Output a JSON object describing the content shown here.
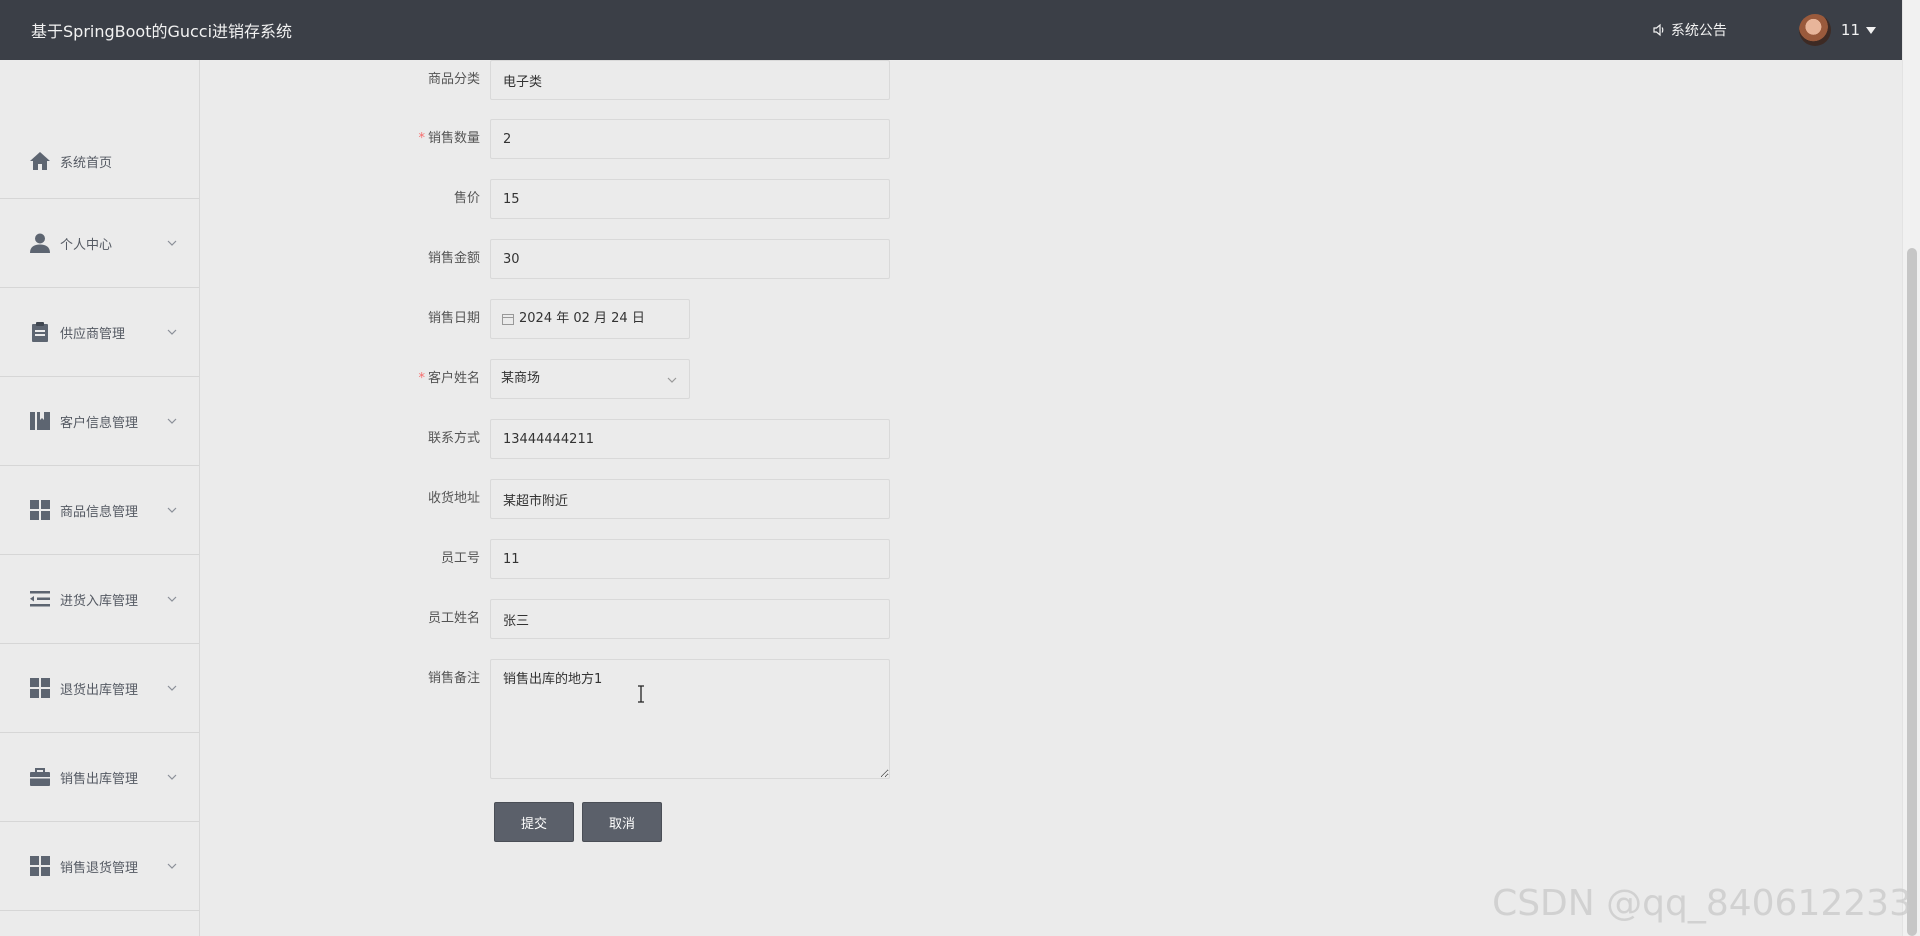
{
  "header": {
    "title": "基于SpringBoot的Gucci进销存系统",
    "notice_label": "系统公告",
    "user_name": "11"
  },
  "sidebar": {
    "items": [
      {
        "label": "系统首页",
        "icon": "home-icon"
      },
      {
        "label": "个人中心",
        "icon": "user-icon"
      },
      {
        "label": "供应商管理",
        "icon": "clipboard-icon"
      },
      {
        "label": "客户信息管理",
        "icon": "book-icon"
      },
      {
        "label": "商品信息管理",
        "icon": "grid-icon"
      },
      {
        "label": "进货入库管理",
        "icon": "list-indent-icon"
      },
      {
        "label": "退货出库管理",
        "icon": "grid-icon"
      },
      {
        "label": "销售出库管理",
        "icon": "briefcase-icon"
      },
      {
        "label": "销售退货管理",
        "icon": "grid-icon"
      }
    ]
  },
  "form": {
    "category": {
      "label": "商品分类",
      "value": "电子类"
    },
    "quantity": {
      "label": "销售数量",
      "value": "2",
      "required": "*"
    },
    "price": {
      "label": "售价",
      "value": "15"
    },
    "amount": {
      "label": "销售金额",
      "value": "30"
    },
    "date": {
      "label": "销售日期",
      "value": "2024 年 02 月 24 日"
    },
    "customer": {
      "label": "客户姓名",
      "value": "某商场",
      "required": "*"
    },
    "contact": {
      "label": "联系方式",
      "value": "13444444211"
    },
    "address": {
      "label": "收货地址",
      "value": "某超市附近"
    },
    "employee_no": {
      "label": "员工号",
      "value": "11"
    },
    "employee_name": {
      "label": "员工姓名",
      "value": "张三"
    },
    "remark": {
      "label": "销售备注",
      "value": "销售出库的地方1"
    },
    "submit_label": "提交",
    "cancel_label": "取消"
  },
  "watermark": "CSDN @qq_840612233",
  "colors": {
    "header_bg": "#3b3f47",
    "button_bg": "#5b606a",
    "required": "#f56c6c",
    "icon": "#5d6571"
  }
}
